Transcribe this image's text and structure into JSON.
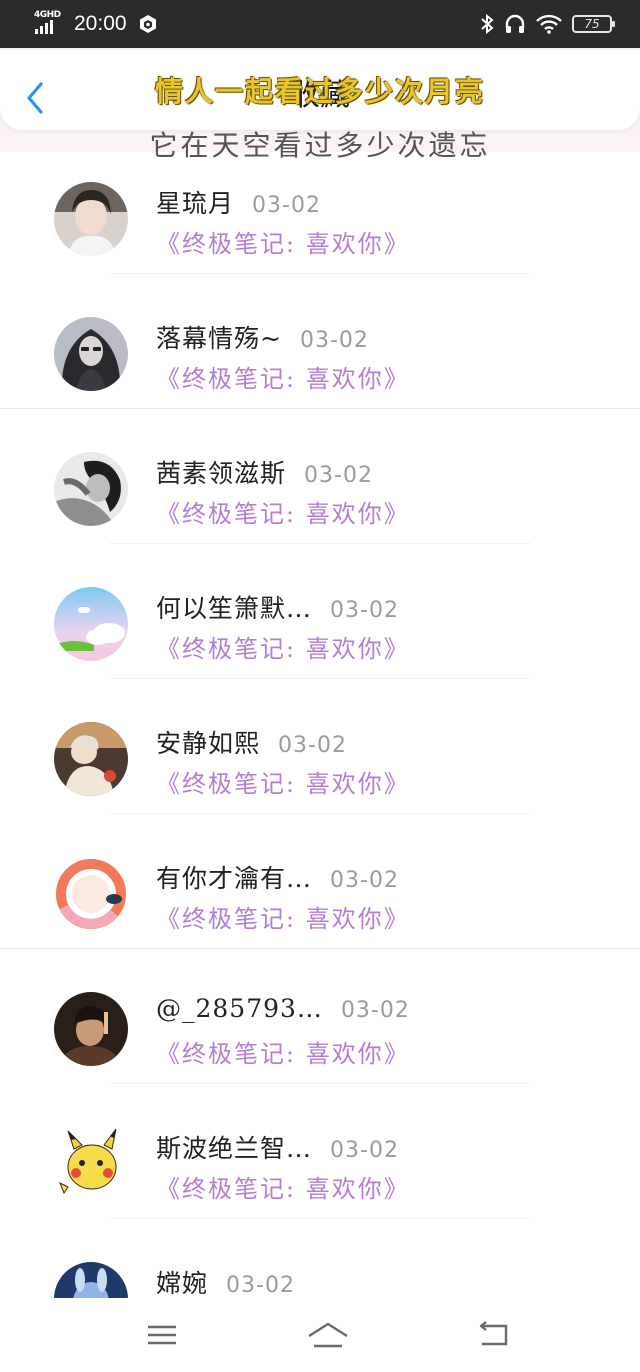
{
  "status_bar": {
    "network": "4GHD",
    "time": "20:00",
    "battery": "75"
  },
  "header": {
    "title": "收藏",
    "overlay_line1": "情人一起看过多少次月亮",
    "overlay_line2": "它在天空看过多少次遗忘"
  },
  "items": [
    {
      "name": "星琉月",
      "date": "03-02",
      "subtitle": "《终极笔记: 喜欢你》"
    },
    {
      "name": "落幕情殇~",
      "date": "03-02",
      "subtitle": "《终极笔记: 喜欢你》"
    },
    {
      "name": "茜素领滋斯",
      "date": "03-02",
      "subtitle": "《终极笔记: 喜欢你》"
    },
    {
      "name": "何以笙箫默…",
      "date": "03-02",
      "subtitle": "《终极笔记: 喜欢你》"
    },
    {
      "name": "安静如熙",
      "date": "03-02",
      "subtitle": "《终极笔记: 喜欢你》"
    },
    {
      "name": "有你才瀹有…",
      "date": "03-02",
      "subtitle": "《终极笔记: 喜欢你》"
    },
    {
      "name": "@_285793…",
      "date": "03-02",
      "subtitle": "《终极笔记: 喜欢你》"
    },
    {
      "name": "斯波绝兰智…",
      "date": "03-02",
      "subtitle": "《终极笔记: 喜欢你》"
    },
    {
      "name": "嫦婉",
      "date": "03-02",
      "subtitle": ""
    }
  ],
  "colors": {
    "accent": "#2196f3",
    "subtitle": "#b57ed6",
    "overlay_yellow": "#e6c52e"
  }
}
